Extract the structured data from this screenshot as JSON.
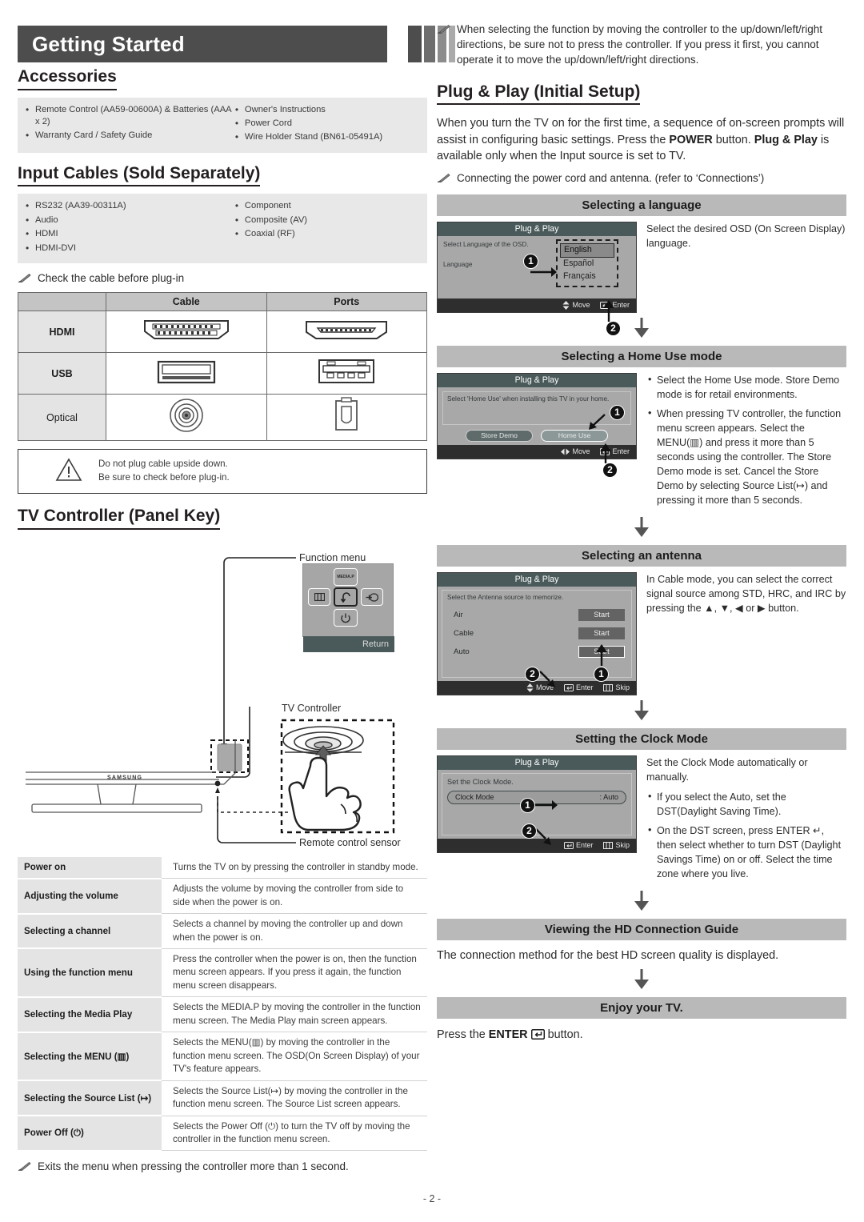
{
  "header": {
    "title": "Getting Started"
  },
  "footer": {
    "page": "- 2 -"
  },
  "accessories": {
    "heading": "Accessories",
    "col1": [
      "Remote Control (AA59-00600A) & Batteries (AAA x 2)",
      "Warranty Card / Safety Guide"
    ],
    "col2": [
      "Owner's Instructions",
      "Power Cord",
      "Wire Holder Stand (BN61-05491A)"
    ]
  },
  "input_cables": {
    "heading": "Input Cables (Sold Separately)",
    "col1": [
      "RS232 (AA39-00311A)",
      "Audio",
      "HDMI",
      "HDMI-DVI"
    ],
    "col2": [
      "Component",
      "Composite (AV)",
      "Coaxial (RF)"
    ],
    "note": "Check the cable before plug-in"
  },
  "cable_table": {
    "headers": [
      "",
      "Cable",
      "Ports"
    ],
    "rows": [
      {
        "label": "HDMI",
        "cable_icon": "hdmi-plug-icon",
        "port_icon": "hdmi-port-icon"
      },
      {
        "label": "USB",
        "cable_icon": "usb-plug-icon",
        "port_icon": "usb-port-icon"
      },
      {
        "label": "Optical",
        "cable_icon": "optical-plug-icon",
        "port_icon": "optical-port-icon"
      }
    ]
  },
  "caution": {
    "line1": "Do not plug cable upside down.",
    "line2": "Be sure to check before plug-in."
  },
  "tv_controller": {
    "heading": "TV Controller (Panel Key)",
    "labels": {
      "function_menu": "Function menu",
      "tv_controller": "TV Controller",
      "remote_sensor": "Remote control sensor",
      "brand": "SAMSUNG"
    },
    "function_menu_buttons": {
      "top": "MEDIA.P",
      "left_icon": "menu-icon",
      "center_icon": "return-icon",
      "right_icon": "source-icon",
      "bottom_icon": "power-icon",
      "return_label": "Return"
    },
    "table": [
      {
        "key": "Power on",
        "desc": "Turns the TV on by pressing the controller in standby mode."
      },
      {
        "key": "Adjusting the volume",
        "desc": "Adjusts the volume by moving the controller from side to side when the power is on."
      },
      {
        "key": "Selecting a channel",
        "desc": "Selects a channel by moving the controller up and down when the power is on."
      },
      {
        "key": "Using the function menu",
        "desc": "Press the controller when the power is on, then the function menu screen appears. If you press it again, the function menu screen disappears."
      },
      {
        "key": "Selecting the Media Play",
        "desc": "Selects the MEDIA.P by moving the controller in the function menu screen. The Media Play main screen appears."
      },
      {
        "key": "Selecting the MENU (▥)",
        "desc": "Selects the MENU(▥) by moving the controller in the function menu screen. The OSD(On Screen Display) of your TV's feature appears."
      },
      {
        "key": "Selecting the Source List (↦)",
        "desc": "Selects the Source List(↦) by moving the controller in the function menu screen. The Source List screen appears."
      },
      {
        "key": "Power Off (⏻)",
        "desc": "Selects the Power Off (⏻) to turn the TV off by moving the controller in the function menu screen."
      }
    ],
    "exit_note": "Exits the menu when pressing the controller more than 1 second."
  },
  "right": {
    "top_note": "When selecting the function by moving the controller to the up/down/left/right directions, be sure not to press the controller. If you press it first, you cannot operate it to move the up/down/left/right directions.",
    "plug_play_heading": "Plug & Play (Initial Setup)",
    "plug_play_body_1": "When you turn the TV on for the first time, a sequence of on-screen prompts will assist in configuring basic settings. Press the ",
    "plug_play_power": "POWER",
    "plug_play_body_2": " button. ",
    "plug_play_bold": "Plug & Play",
    "plug_play_body_3": " is available only when the Input source is set to TV.",
    "connect_note": "Connecting the power cord and antenna. (refer to ‘Connections’)"
  },
  "steps": [
    {
      "bar": "Selecting a language",
      "osd": {
        "title": "Plug & Play",
        "sub": "Select Language of the OSD.",
        "field_label": "Language",
        "options": [
          "English",
          "Español",
          "Français"
        ],
        "selected": "English",
        "footer": [
          {
            "icon": "updown-icon",
            "label": "Move"
          },
          {
            "icon": "enter-icon",
            "label": "Enter"
          }
        ]
      },
      "badges": [
        "1",
        "2"
      ],
      "text": "Select the desired OSD (On Screen Display) language."
    },
    {
      "bar": "Selecting a Home Use mode",
      "osd": {
        "title": "Plug & Play",
        "sub": "Select 'Home Use' when installing this TV in your home.",
        "buttons": [
          "Store Demo",
          "Home Use"
        ],
        "selected": "Home Use",
        "footer": [
          {
            "icon": "leftright-icon",
            "label": "Move"
          },
          {
            "icon": "enter-icon",
            "label": "Enter"
          }
        ]
      },
      "badges": [
        "1",
        "2"
      ],
      "bullets": [
        "Select the Home Use mode. Store Demo mode is for retail environments.",
        "When pressing TV controller, the function menu screen appears. Select the MENU(▥) and press it more than 5 seconds using the controller. The Store Demo mode is set. Cancel the Store Demo by selecting Source List(↦) and pressing it more than 5 seconds."
      ]
    },
    {
      "bar": "Selecting an antenna",
      "osd": {
        "title": "Plug & Play",
        "sub": "Select the Antenna source to memorize.",
        "rows": [
          {
            "name": "Air",
            "button": "Start"
          },
          {
            "name": "Cable",
            "button": "Start"
          },
          {
            "name": "Auto",
            "button": "Start"
          }
        ],
        "highlighted": "Auto",
        "footer": [
          {
            "icon": "updown-icon",
            "label": "Move"
          },
          {
            "icon": "enter-icon",
            "label": "Enter"
          },
          {
            "icon": "menu-icon",
            "label": "Skip"
          }
        ]
      },
      "badges": [
        "1",
        "2"
      ],
      "text": "In Cable mode, you can select the correct signal source among STD, HRC, and IRC by pressing the ▲, ▼, ◀ or ▶ button."
    },
    {
      "bar": "Setting the Clock Mode",
      "osd": {
        "title": "Plug & Play",
        "sub": "Set the Clock Mode.",
        "field_label": "Clock Mode",
        "field_value": ": Auto",
        "footer": [
          {
            "icon": "enter-icon",
            "label": "Enter"
          },
          {
            "icon": "menu-icon",
            "label": "Skip"
          }
        ]
      },
      "badges": [
        "1",
        "2"
      ],
      "lead": "Set the Clock Mode automatically or manually.",
      "bullets": [
        "If you select the Auto, set the DST(Daylight Saving Time).",
        "On the DST screen, press ENTER ↵, then select whether to turn DST (Daylight Savings Time) on or off. Select the time zone where you live."
      ]
    },
    {
      "bar": "Viewing the HD Connection Guide",
      "text": "The connection method for the best HD screen quality is displayed."
    },
    {
      "bar": "Enjoy your TV.",
      "text_pre": "Press the ",
      "text_bold": "ENTER",
      "text_post": " button."
    }
  ]
}
